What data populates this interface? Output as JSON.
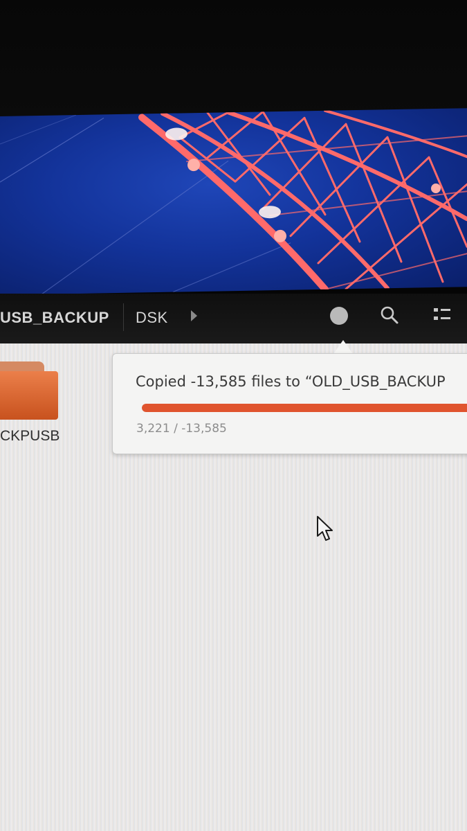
{
  "pathbar": {
    "current_folder": "USB_BACKUP",
    "next_segment": "DSK"
  },
  "icons": {
    "forward": "chevron-right-icon",
    "operations": "file-operations-progress-icon",
    "search": "search-icon",
    "view": "view-options-icon",
    "folder": "folder-icon",
    "cursor": "mouse-pointer-icon"
  },
  "files": [
    {
      "name": "CKPUSB"
    }
  ],
  "operation": {
    "title": "Copied -13,585 files to “OLD_USB_BACKUP",
    "detail": "3,221 / -13,585",
    "progress": 1.0
  },
  "colors": {
    "accent": "#e0542e",
    "folder": "#e46f3a",
    "headerbar": "#141414",
    "background": "#ecebea",
    "wallpaper": "#13339a"
  }
}
